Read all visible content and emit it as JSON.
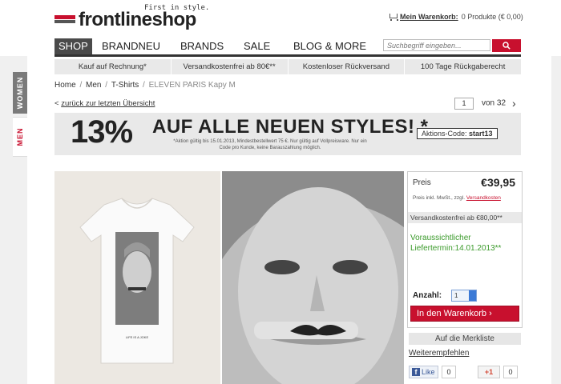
{
  "logo": {
    "name": "frontlineshop",
    "tagline": "First in style."
  },
  "cart": {
    "title": "Mein Warenkorb:",
    "summary": "0 Produkte (€ 0,00)"
  },
  "side_tabs": {
    "women": "WOMEN",
    "men": "MEN"
  },
  "nav": {
    "items": [
      "SHOP",
      "BRANDNEU",
      "BRANDS",
      "SALE",
      "BLOG & MORE"
    ],
    "active": "SHOP"
  },
  "search": {
    "placeholder": "Suchbegriff eingeben..."
  },
  "benefits": [
    "Kauf auf Rechnung*",
    "Versandkostenfrei ab 80€**",
    "Kostenloser Rückversand",
    "100 Tage Rückgaberecht"
  ],
  "breadcrumb": {
    "items": [
      "Home",
      "Men",
      "T-Shirts"
    ],
    "current": "ELEVEN PARIS Kapy M"
  },
  "back_link": {
    "arrow": "<",
    "label": "zurück zur letzten Übersicht"
  },
  "pager": {
    "current": "1",
    "total_label": "von 32"
  },
  "banner": {
    "percent": "13%",
    "headline": "AUF ALLE NEUEN STYLES! *",
    "fine_print": "*Aktion gültig bis 15.01.2013, Mindestbestellwert 75 €. Nur gültig auf Vollpreisware. Nur ein Code pro Kunde, keine Barauszahlung möglich.",
    "code_label": "Aktions-Code:",
    "code": "start13"
  },
  "product": {
    "shirt_print": "LIFE IS A JOKE"
  },
  "buybox": {
    "price_label": "Preis",
    "price": "€39,95",
    "price_note": "Preis inkl. MwSt., zzgl.",
    "shipping_link": "Versandkosten",
    "free_shipping": "Versandkostenfrei ab €80,00**",
    "delivery_line1": "Voraussichtlicher",
    "delivery_line2": "Liefertermin:14.01.2013**",
    "qty_label": "Anzahl:",
    "qty_value": "1",
    "add_to_cart": "In den Warenkorb ›"
  },
  "wishlist": "Auf die Merkliste",
  "recommend": "Weiterempfehlen",
  "social": {
    "fb_label": "Like",
    "fb_count": "0",
    "gplus_label": "+1",
    "gplus_count": "0"
  },
  "colors": {
    "accent": "#c8102e",
    "nav_active": "#4a4a4a",
    "delivery_green": "#3a9a2a"
  }
}
